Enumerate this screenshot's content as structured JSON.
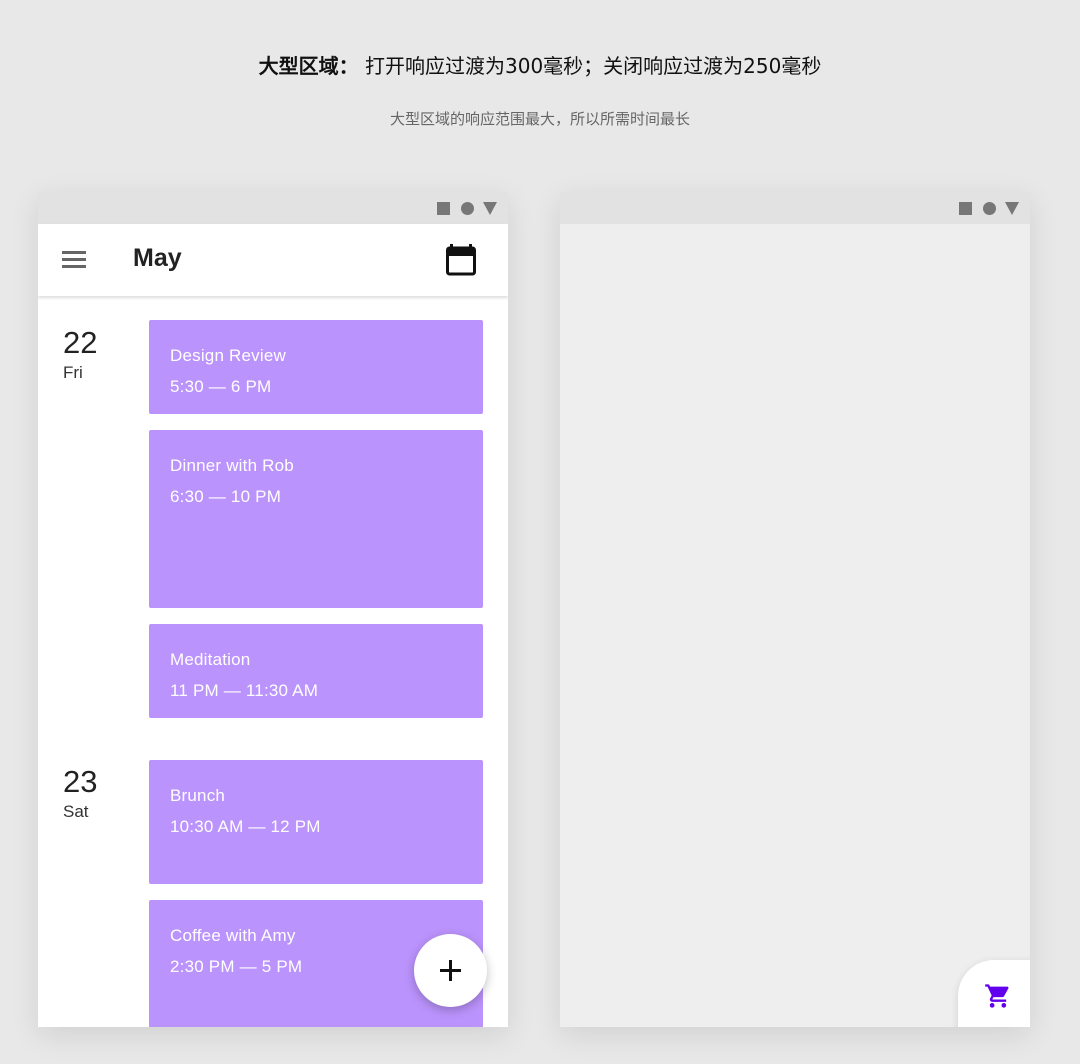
{
  "caption": {
    "title_bold": "大型区域：",
    "title_rest": "打开响应过渡为300毫秒；关闭响应过渡为250毫秒",
    "subtitle": "大型区域的响应范围最大，所以所需时间最长"
  },
  "left_phone": {
    "appbar": {
      "title": "May",
      "menu_icon": "menu-icon",
      "action_icon": "calendar-icon"
    },
    "days": [
      {
        "number": "22",
        "name": "Fri",
        "events": [
          {
            "title": "Design Review",
            "time": "5:30 — 6 PM"
          },
          {
            "title": "Dinner with Rob",
            "time": "6:30 — 10 PM"
          },
          {
            "title": "Meditation",
            "time": "11 PM — 11:30 AM"
          }
        ]
      },
      {
        "number": "23",
        "name": "Sat",
        "events": [
          {
            "title": "Brunch",
            "time": "10:30 AM — 12 PM"
          },
          {
            "title": "Coffee with Amy",
            "time": "2:30 PM — 5 PM"
          }
        ]
      }
    ],
    "fab_icon": "plus-icon"
  },
  "right_phone": {
    "cart_icon": "shopping-cart-icon"
  },
  "colors": {
    "event_bg": "#bb93fc",
    "accent": "#6200ee",
    "status_bar": "#e2e2e2",
    "page_bg": "#e8e8e8"
  }
}
